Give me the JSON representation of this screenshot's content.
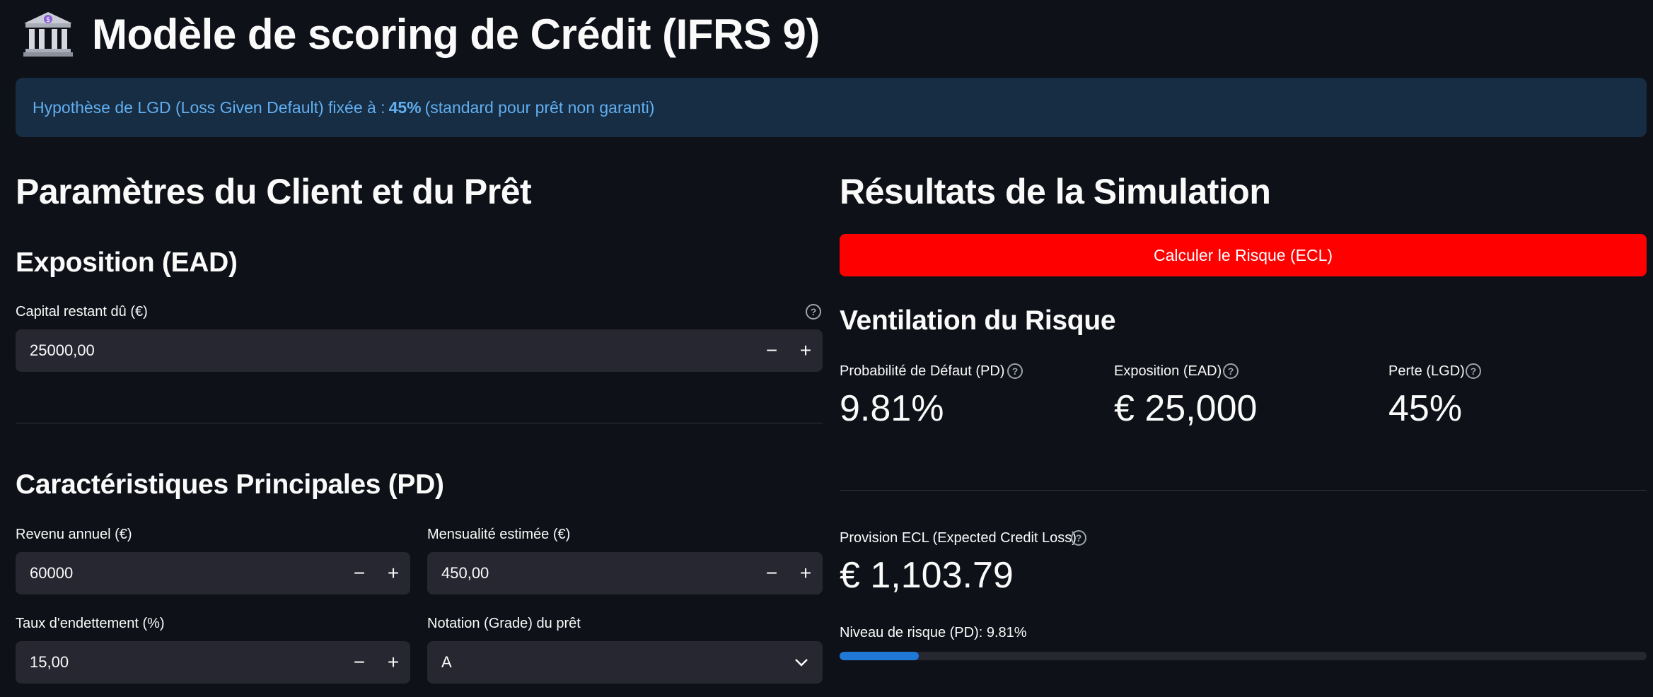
{
  "header": {
    "icon": "bank-icon",
    "title": "Modèle de scoring de Crédit (IFRS 9)"
  },
  "info_banner": {
    "prefix": "Hypothèse de LGD (Loss Given Default) fixée à :",
    "value": "45%",
    "suffix": "(standard pour prêt non garanti)"
  },
  "left": {
    "section_title": "Paramètres du Client et du Prêt",
    "exposition": {
      "title": "Exposition (EAD)",
      "capital_label": "Capital restant dû (€)",
      "capital_value": "25000,00"
    },
    "caracteristiques": {
      "title": "Caractéristiques Principales (PD)",
      "revenu_label": "Revenu annuel (€)",
      "revenu_value": "60000",
      "mensualite_label": "Mensualité estimée (€)",
      "mensualite_value": "450,00",
      "taux_label": "Taux d'endettement (%)",
      "taux_value": "15,00",
      "notation_label": "Notation (Grade) du prêt",
      "notation_value": "A"
    },
    "stepper": {
      "minus": "−",
      "plus": "+"
    }
  },
  "right": {
    "section_title": "Résultats de la Simulation",
    "button_label": "Calculer le Risque (ECL)",
    "ventilation_title": "Ventilation du Risque",
    "metrics": [
      {
        "label": "Probabilité de Défaut (PD)",
        "value": "9.81%"
      },
      {
        "label": "Exposition (EAD)",
        "value": "€ 25,000"
      },
      {
        "label": "Perte (LGD)",
        "value": "45%"
      }
    ],
    "ecl": {
      "label": "Provision ECL (Expected Credit Loss)",
      "value": "€ 1,103.79"
    },
    "risk_level": {
      "label": "Niveau de risque (PD): 9.81%",
      "progress": 0.0981
    }
  },
  "colors": {
    "background": "#0e1117",
    "banner_bg": "#172d43",
    "banner_text": "#61aef0",
    "button": "#ff0000",
    "input_bg": "#262730",
    "progress": "#1f77d8"
  }
}
